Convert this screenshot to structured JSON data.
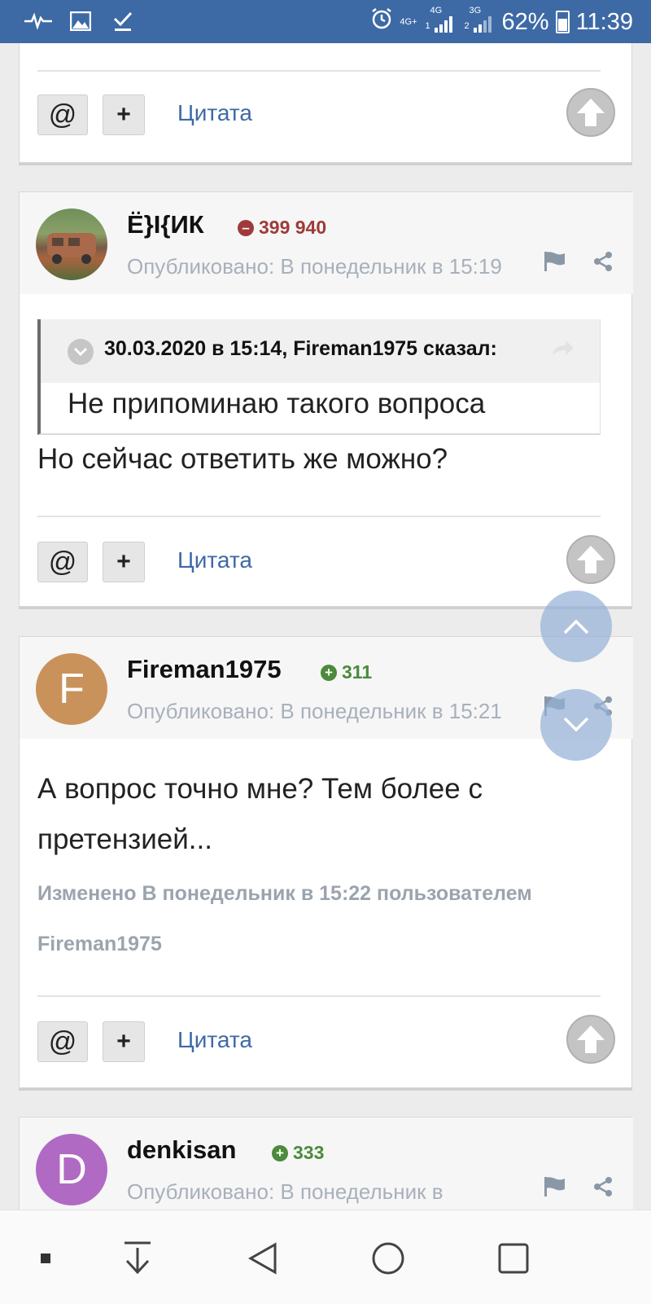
{
  "status_bar": {
    "battery": "62%",
    "time": "11:39",
    "net_4g_plus": "4G+",
    "net_4g": "4G",
    "net_3g": "3G",
    "sim1": "1",
    "sim2": "2"
  },
  "actions": {
    "mention": "@",
    "add": "+",
    "quote": "Цитата"
  },
  "posts": [
    {
      "author": "Ё}I{ИК",
      "reputation": "399 940",
      "reputation_sign": "negative",
      "published": "Опубликовано: В понедельник в 15:19",
      "quote_citation": "30.03.2020 в 15:14, Fireman1975 сказал:",
      "quote_text": "Не припоминаю такого вопроса",
      "message": "Но сейчас ответить же можно?"
    },
    {
      "author": "Fireman1975",
      "avatar_letter": "F",
      "reputation": "311",
      "reputation_sign": "positive",
      "published": "Опубликовано: В понедельник в 15:21",
      "message": "А вопрос точно мне? Тем более с претензией...",
      "edited": "Изменено В понедельник в 15:22 пользователем Fireman1975"
    },
    {
      "author": "denkisan",
      "avatar_letter": "D",
      "reputation": "333",
      "reputation_sign": "positive",
      "published": "Опубликовано: В понедельник в"
    }
  ],
  "colors": {
    "status_bar": "#3d6aa5",
    "link": "#3d6aa5",
    "rep_negative": "#a03a3a",
    "rep_positive": "#4c8a3c",
    "avatar_f": "#c9925b",
    "avatar_d": "#b06ac4"
  }
}
